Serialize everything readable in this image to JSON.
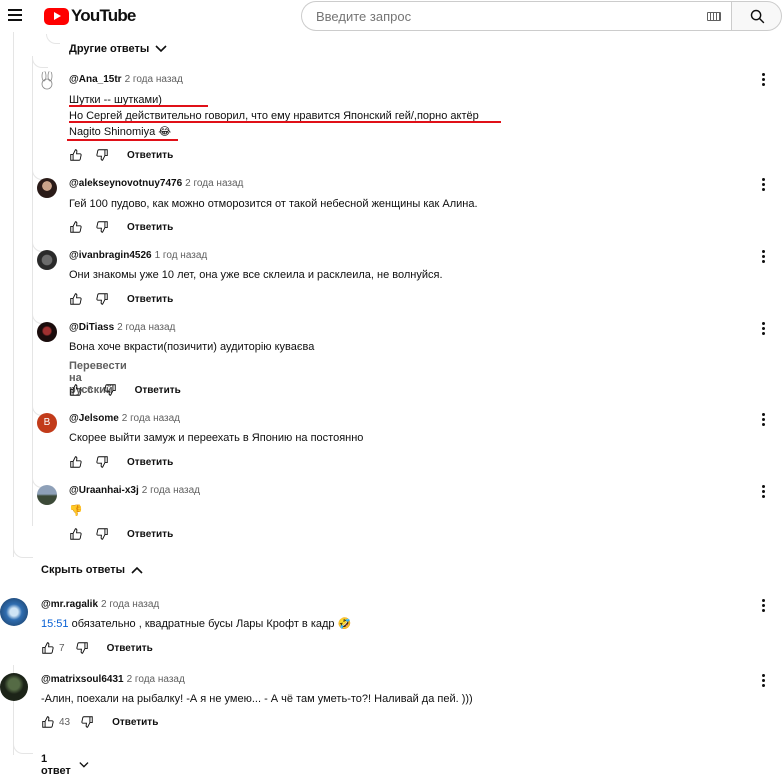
{
  "header": {
    "logo_text": "YouTube",
    "search_placeholder": "Введите запрос"
  },
  "thread": {
    "more_replies_label": "Другие ответы",
    "hide_replies_label": "Скрыть ответы"
  },
  "reply_label": "Ответить",
  "replies": [
    {
      "author": "@Ana_15tr",
      "time": "2 года назад",
      "lines": [
        "Шутки -- шутками)",
        "Но Сергей действительно говорил, что ему нравится Японский гей/,порно актёр",
        "Nagito Shinomiya 😂"
      ],
      "likes": ""
    },
    {
      "author": "@alekseynovotnuy7476",
      "time": "2 года назад",
      "lines": [
        "Гей 100 пудово, как можно отморозится от такой небесной женщины как Алина."
      ],
      "likes": ""
    },
    {
      "author": "@ivanbragin4526",
      "time": "1 год назад",
      "lines": [
        "Они знакомы уже 10 лет, она уже все склеила и расклеила, не волнуйся."
      ],
      "likes": ""
    },
    {
      "author": "@DiTiass",
      "time": "2 года назад",
      "lines": [
        "Вона хоче вкрасти(позичити) аудиторію куваєва"
      ],
      "translate": "Перевести на русский",
      "likes": "6"
    },
    {
      "author": "@Jelsome",
      "time": "2 года назад",
      "avatar_letter": "B",
      "lines": [
        "Скорее выйти замуж и переехать в Японию на постоянно"
      ],
      "likes": ""
    },
    {
      "author": "@Uraanhai-x3j",
      "time": "2 года назад",
      "lines": [
        "👎"
      ],
      "likes": ""
    }
  ],
  "comments": [
    {
      "author": "@mr.ragalik",
      "time": "2 года назад",
      "timestamp_link": "15:51",
      "text": " обязательно , квадратные бусы Лары Крофт в кадр 🤣",
      "likes": "7"
    },
    {
      "author": "@matrixsoul6431",
      "time": "2 года назад",
      "text": "-Алин, поехали на рыбалку! -А я не умею... - А чё там уметь-то?! Наливай да пей. )))",
      "likes": "43",
      "replies_count_label": "1 ответ"
    }
  ],
  "colors": {
    "accent_red": "#ff0000",
    "link_blue": "#065fd4",
    "annotation_red": "#e01018",
    "jelsome_avatar": "#c23b1a"
  }
}
